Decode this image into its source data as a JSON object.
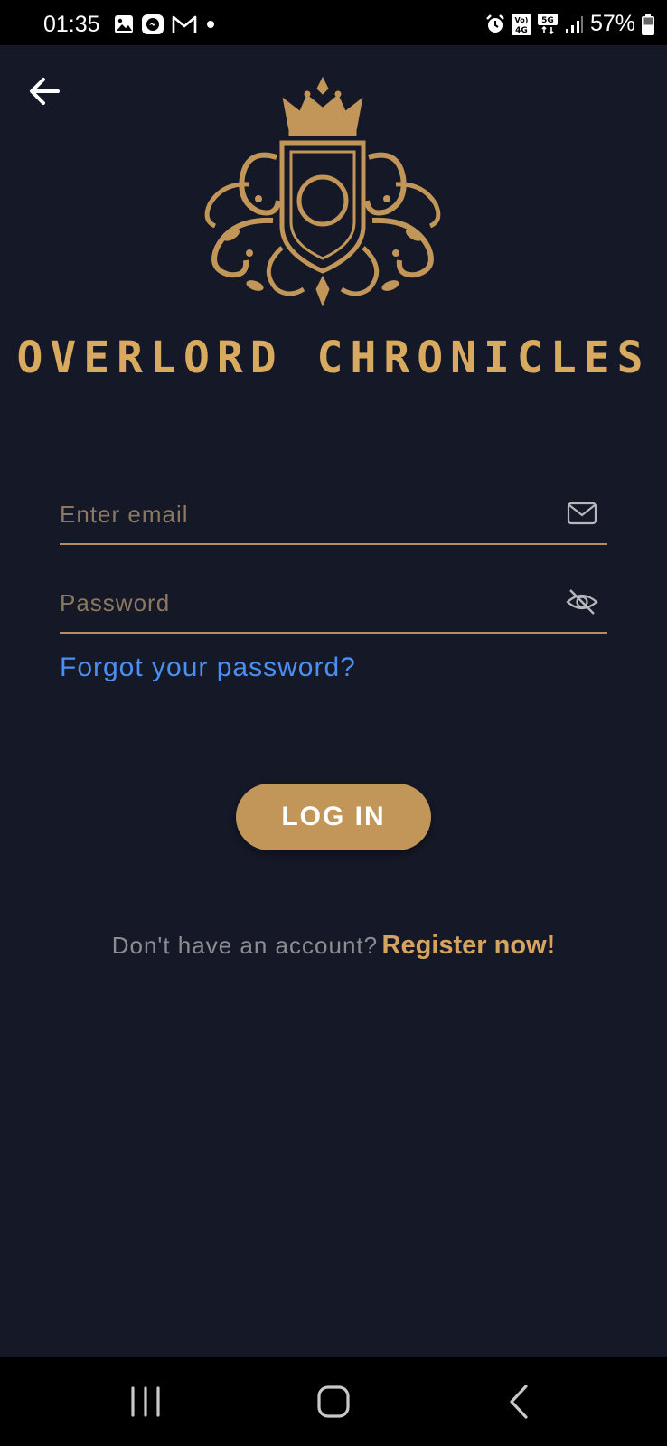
{
  "status_bar": {
    "time": "01:35",
    "battery": "57%",
    "left_icons": [
      "image-icon",
      "messenger-icon",
      "gmail-icon",
      "dot-icon"
    ],
    "right_icons": [
      "alarm-icon",
      "volte-icon",
      "5g-icon",
      "signal-icon",
      "battery-icon"
    ]
  },
  "app": {
    "brand_name": "OVERLORD CHRONICLES",
    "logo_icon": "crest-logo-icon",
    "back_icon": "arrow-left-icon"
  },
  "form": {
    "email_placeholder": "Enter email",
    "email_icon": "mail-icon",
    "password_placeholder": "Password",
    "password_icon": "eye-off-icon",
    "forgot_password": "Forgot your password?",
    "login_label": "LOG IN",
    "register_prompt": "Don't have an account?",
    "register_link": "Register now!"
  },
  "colors": {
    "background": "#151826",
    "accent_gold": "#c29658",
    "link_blue": "#4b8ff2",
    "field_line": "#b88e57"
  },
  "nav_bar": {
    "buttons": [
      "recents-icon",
      "home-icon",
      "back-icon"
    ]
  }
}
